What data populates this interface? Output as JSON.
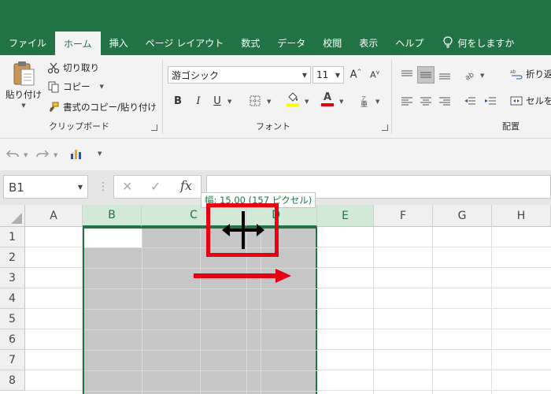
{
  "tabs": [
    {
      "label": "ファイル",
      "active": false
    },
    {
      "label": "ホーム",
      "active": true
    },
    {
      "label": "挿入",
      "active": false
    },
    {
      "label": "ページ レイアウト",
      "active": false
    },
    {
      "label": "数式",
      "active": false
    },
    {
      "label": "データ",
      "active": false
    },
    {
      "label": "校閲",
      "active": false
    },
    {
      "label": "表示",
      "active": false
    },
    {
      "label": "ヘルプ",
      "active": false
    }
  ],
  "tell_me": "何をしますか",
  "clipboard": {
    "paste_label": "貼り付け",
    "cut_label": "切り取り",
    "copy_label": "コピー",
    "format_painter_label": "書式のコピー/貼り付け",
    "group_label": "クリップボード"
  },
  "font": {
    "font_name": "游ゴシック",
    "font_size": "11",
    "group_label": "フォント",
    "bold": "B",
    "italic": "I",
    "underline": "U",
    "font_color_letter": "A",
    "font_color": "#e60012",
    "fill_color": "#ffff00"
  },
  "alignment": {
    "wrap_text_label": "折り返",
    "merge_label": "セルを",
    "group_label": "配置"
  },
  "formula_bar": {
    "name_box": "B1",
    "fx": "fx",
    "cancel": "✕",
    "enter": "✓",
    "formula": ""
  },
  "tooltip": "幅: 15.00 (157 ピクセル)",
  "columns": [
    {
      "label": "A",
      "selected": false
    },
    {
      "label": "B",
      "selected": true
    },
    {
      "label": "C",
      "selected": true
    },
    {
      "label": "D",
      "selected": true
    },
    {
      "label": "E",
      "selected": true
    },
    {
      "label": "F",
      "selected": false
    },
    {
      "label": "G",
      "selected": false
    },
    {
      "label": "H",
      "selected": false
    }
  ],
  "rows": [
    "1",
    "2",
    "3",
    "4",
    "5",
    "6",
    "7",
    "8"
  ],
  "colors": {
    "excel_green": "#217346",
    "annotation_red": "#e60012",
    "selection_fill": "#c6c6c6"
  }
}
